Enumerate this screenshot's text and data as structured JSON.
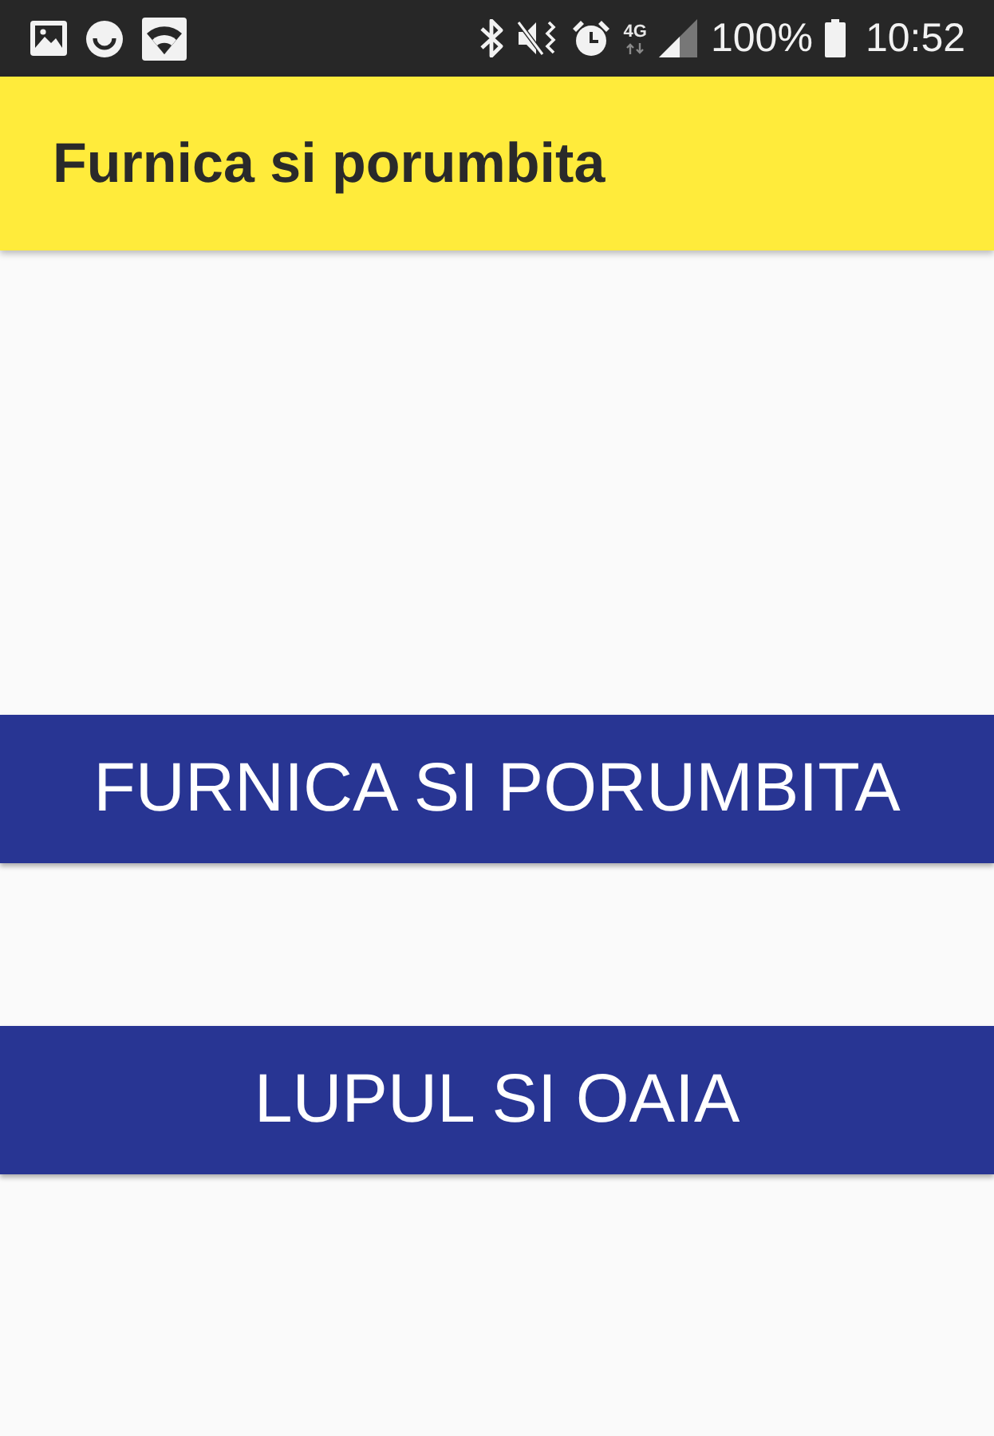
{
  "status_bar": {
    "network": "4G",
    "battery": "100%",
    "time": "10:52"
  },
  "app_bar": {
    "title": "Furnica si porumbita"
  },
  "buttons": [
    {
      "label": "FURNICA SI PORUMBITA"
    },
    {
      "label": "LUPUL SI OAIA"
    }
  ]
}
